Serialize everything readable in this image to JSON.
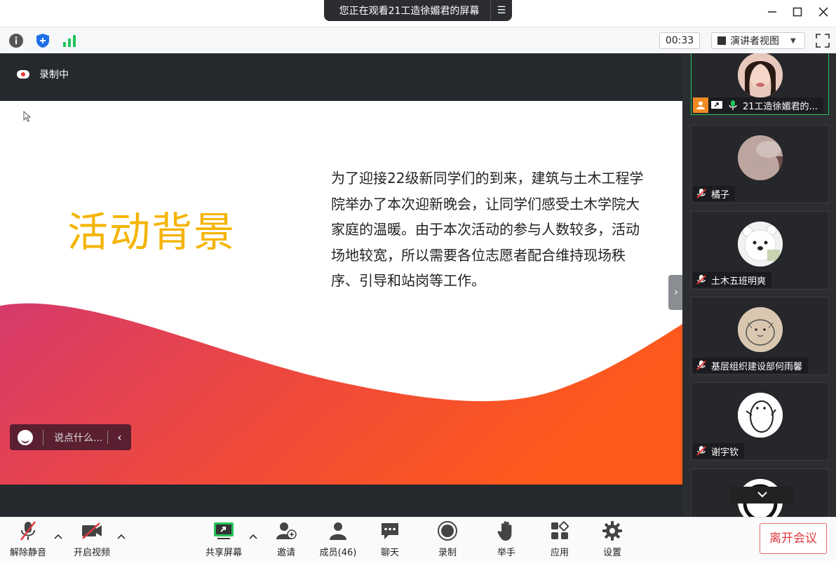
{
  "window": {
    "viewing_banner": "您正在观看21工造徐媚君的屏幕",
    "controls": [
      "minimize",
      "maximize",
      "close"
    ]
  },
  "infobar": {
    "icons": [
      "info-icon",
      "shield-icon",
      "signal-icon"
    ],
    "timer": "00:33",
    "view_mode": "演讲者视图"
  },
  "stage": {
    "recording_label": "录制中",
    "slide": {
      "title": "活动背景",
      "title_color": "#f5b400",
      "body": "为了迎接22级新同学们的到来，建筑与土木工程学院举办了本次迎新晚会，让同学们感受土木学院大家庭的温暖。由于本次活动的参与人数较多，活动场地较宽，所以需要各位志愿者配合维持现场秩序、引导和站岗等工作。"
    },
    "chat_placeholder": "说点什么..."
  },
  "participants": [
    {
      "name": "21工造徐媚君的...",
      "active": true,
      "mic": "on"
    },
    {
      "name": "橘子",
      "active": false,
      "mic": "muted"
    },
    {
      "name": "土木五班明爽",
      "active": false,
      "mic": "muted"
    },
    {
      "name": "基层组织建设部何雨馨",
      "active": false,
      "mic": "muted"
    },
    {
      "name": "谢宇钦",
      "active": false,
      "mic": "muted"
    }
  ],
  "toolbar": {
    "unmute": "解除静音",
    "start_video": "开启视频",
    "share_screen": "共享屏幕",
    "invite": "邀请",
    "members": "成员(46)",
    "chat": "聊天",
    "record": "录制",
    "raise_hand": "举手",
    "apps": "应用",
    "settings": "设置",
    "leave": "离开会议"
  },
  "colors": {
    "accent_green": "#23c45a",
    "leave_red": "#e0393e",
    "wave_start": "#d63a6b",
    "wave_end": "#ff5a1a"
  }
}
